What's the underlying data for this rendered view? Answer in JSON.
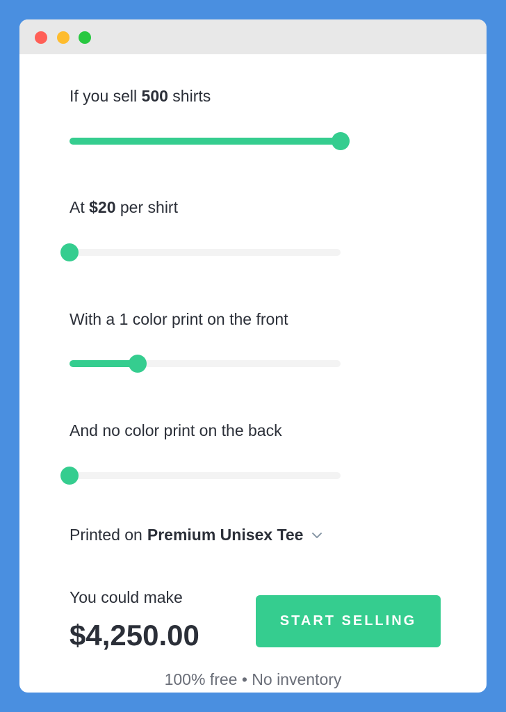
{
  "window": {
    "controls": [
      "close",
      "minimize",
      "maximize"
    ],
    "colors": {
      "close": "#ff5f57",
      "minimize": "#febc2e",
      "maximize": "#28c840"
    }
  },
  "calculator": {
    "quantity": {
      "prefix": "If you sell ",
      "value": "500",
      "suffix": " shirts",
      "slider_fraction": 1.0
    },
    "price": {
      "prefix": "At ",
      "value": "$20",
      "suffix": " per shirt",
      "slider_fraction": 0.0
    },
    "front_print": {
      "prefix": "With a ",
      "value": "1",
      "suffix": " color print on the front",
      "slider_fraction": 0.25
    },
    "back_print": {
      "text": "And no color print on the back",
      "slider_fraction": 0.0
    },
    "product": {
      "prefix": "Printed on",
      "name": "Premium Unisex Tee",
      "icon": "chevron-down-icon"
    },
    "earnings": {
      "label": "You could make",
      "amount": "$4,250.00"
    },
    "cta_label": "START SELLING",
    "footnote": "100% free • No inventory"
  },
  "colors": {
    "accent": "#35cd8f",
    "background": "#4a8fe0",
    "text": "#2b2f38"
  }
}
